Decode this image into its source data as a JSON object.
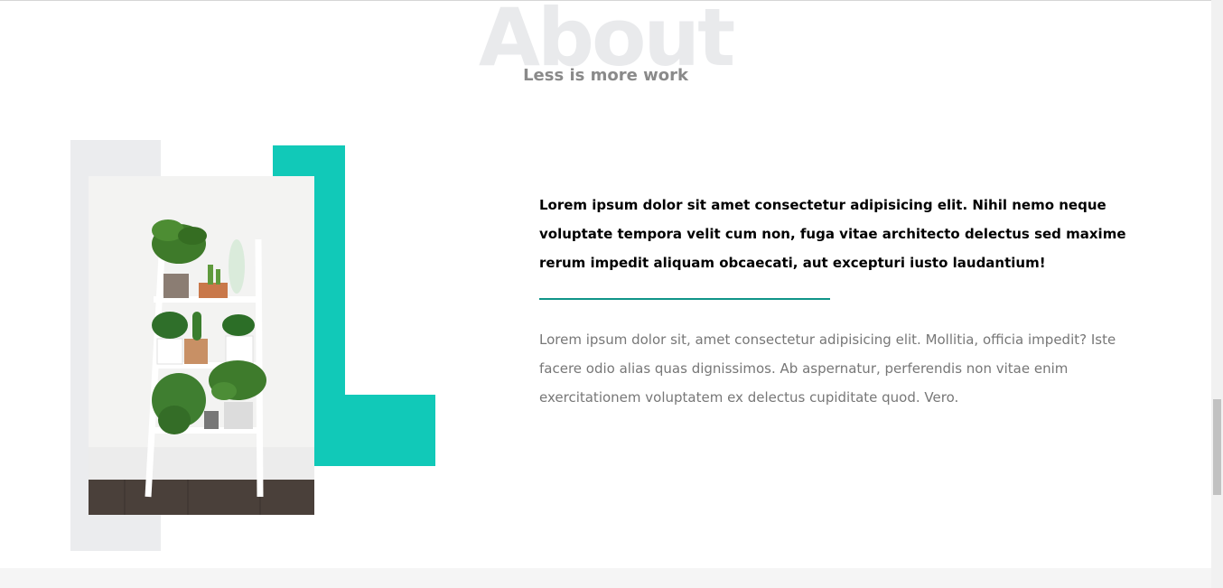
{
  "section": {
    "background_title": "About",
    "subtitle": "Less is more work"
  },
  "content": {
    "lead": "Lorem ipsum dolor sit amet consectetur adipisicing elit. Nihil nemo neque voluptate tempora velit cum non, fuga vitae architecto delectus sed maxime rerum impedit aliquam obcaecati, aut excepturi iusto laudantium!",
    "body": "Lorem ipsum dolor sit, amet consectetur adipisicing elit. Mollitia, officia impedit? Iste facere odio alias quas dignissimos. Ab aspernatur, perferendis non vitae enim exercitationem voluptatem ex delectus cupiditate quod. Vero."
  },
  "colors": {
    "accent": "#11c9b8",
    "divider": "#0f9488",
    "background_title": "#e9eaec",
    "muted_text": "#777777"
  }
}
